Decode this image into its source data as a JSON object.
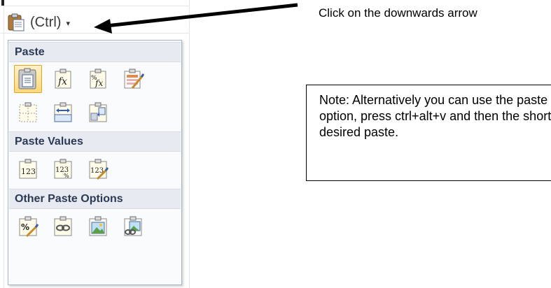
{
  "paste_button": {
    "label": "(Ctrl)",
    "icon": "clipboard-icon",
    "dropdown_icon": "dropdown-arrow-icon"
  },
  "callout": {
    "text": "Click on the downwards arrow"
  },
  "note": {
    "text": "Note: Alternatively you can use the paste special option, press ctrl+alt+v and then the short cut key of desired paste."
  },
  "menu": {
    "sections": [
      {
        "title": "Paste",
        "options": [
          "paste-icon",
          "paste-formulas-icon",
          "paste-formulas-number-formatting-icon",
          "keep-source-formatting-icon",
          "no-borders-icon",
          "transpose-icon",
          "keep-source-column-widths-icon"
        ]
      },
      {
        "title": "Paste Values",
        "options": [
          "values-icon",
          "values-number-formatting-icon",
          "values-source-formatting-icon"
        ]
      },
      {
        "title": "Other Paste Options",
        "options": [
          "formatting-icon",
          "paste-link-icon",
          "picture-icon",
          "linked-picture-icon"
        ]
      }
    ]
  },
  "colors": {
    "menu_border": "#a8b3c2",
    "header_bg": "#e7ebf1",
    "header_text": "#2b3a55",
    "selected": "#ffd97a"
  }
}
